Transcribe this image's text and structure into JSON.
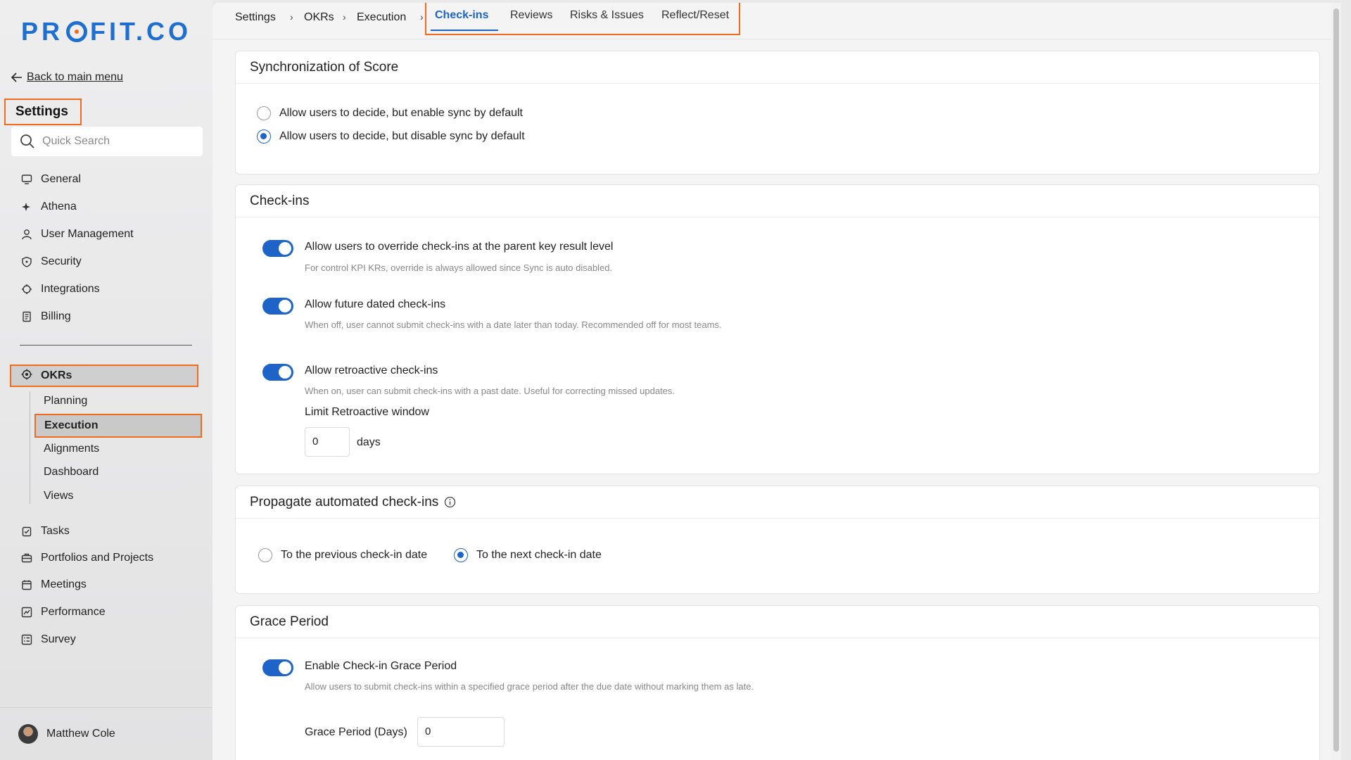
{
  "sidebar": {
    "logo": "PROFIT.CO",
    "back_label": "Back to main menu",
    "title": "Settings",
    "search_placeholder": "Quick Search",
    "items": [
      {
        "label": "General",
        "icon": "monitor-icon"
      },
      {
        "label": "Athena",
        "icon": "sparkle-icon"
      },
      {
        "label": "User Management",
        "icon": "user-icon"
      },
      {
        "label": "Security",
        "icon": "shield-icon"
      },
      {
        "label": "Integrations",
        "icon": "puzzle-icon"
      },
      {
        "label": "Billing",
        "icon": "receipt-icon"
      }
    ],
    "okrs_label": "OKRs",
    "okr_sub": [
      "Planning",
      "Execution",
      "Alignments",
      "Dashboard",
      "Views"
    ],
    "items_bottom": [
      {
        "label": "Tasks",
        "icon": "clipboard-check-icon"
      },
      {
        "label": "Portfolios and Projects",
        "icon": "briefcase-icon"
      },
      {
        "label": "Meetings",
        "icon": "calendar-icon"
      },
      {
        "label": "Performance",
        "icon": "chart-icon"
      },
      {
        "label": "Survey",
        "icon": "survey-icon"
      }
    ],
    "user_name": "Matthew Cole"
  },
  "breadcrumb": [
    "Settings",
    "OKRs",
    "Execution"
  ],
  "tabs": [
    "Check-ins",
    "Reviews",
    "Risks & Issues",
    "Reflect/Reset"
  ],
  "sync": {
    "title": "Synchronization of Score",
    "options": [
      {
        "label": "Allow users to decide, but enable sync by default",
        "selected": false
      },
      {
        "label": "Allow users to decide, but disable sync by default",
        "selected": true
      }
    ]
  },
  "checkins": {
    "title": "Check-ins",
    "opt1_title": "Allow users to override check-ins at the parent key result level",
    "opt1_desc": "For control KPI KRs, override is always allowed since Sync is auto disabled.",
    "opt2_title": "Allow future dated check-ins",
    "opt2_desc": "When off, user cannot submit check-ins with a date later than today. Recommended off for most teams.",
    "opt3_title": "Allow retroactive check-ins",
    "opt3_desc": "When on, user can submit check-ins with a past date. Useful for correcting missed updates.",
    "limit_label": "Limit Retroactive window",
    "limit_value": "0",
    "limit_unit": "days"
  },
  "propagate": {
    "title": "Propagate automated check-ins",
    "options": [
      {
        "label": "To the previous check-in date",
        "selected": false
      },
      {
        "label": "To the next check-in date",
        "selected": true
      }
    ]
  },
  "grace": {
    "title": "Grace Period",
    "opt_title": "Enable Check-in Grace Period",
    "opt_desc": "Allow users to submit check-ins within a specified grace period after the due date without marking them as late.",
    "days_label": "Grace Period (Days)",
    "days_value": "0"
  },
  "colors": {
    "accent": "#1e63c8",
    "highlight": "#f06b1c"
  }
}
